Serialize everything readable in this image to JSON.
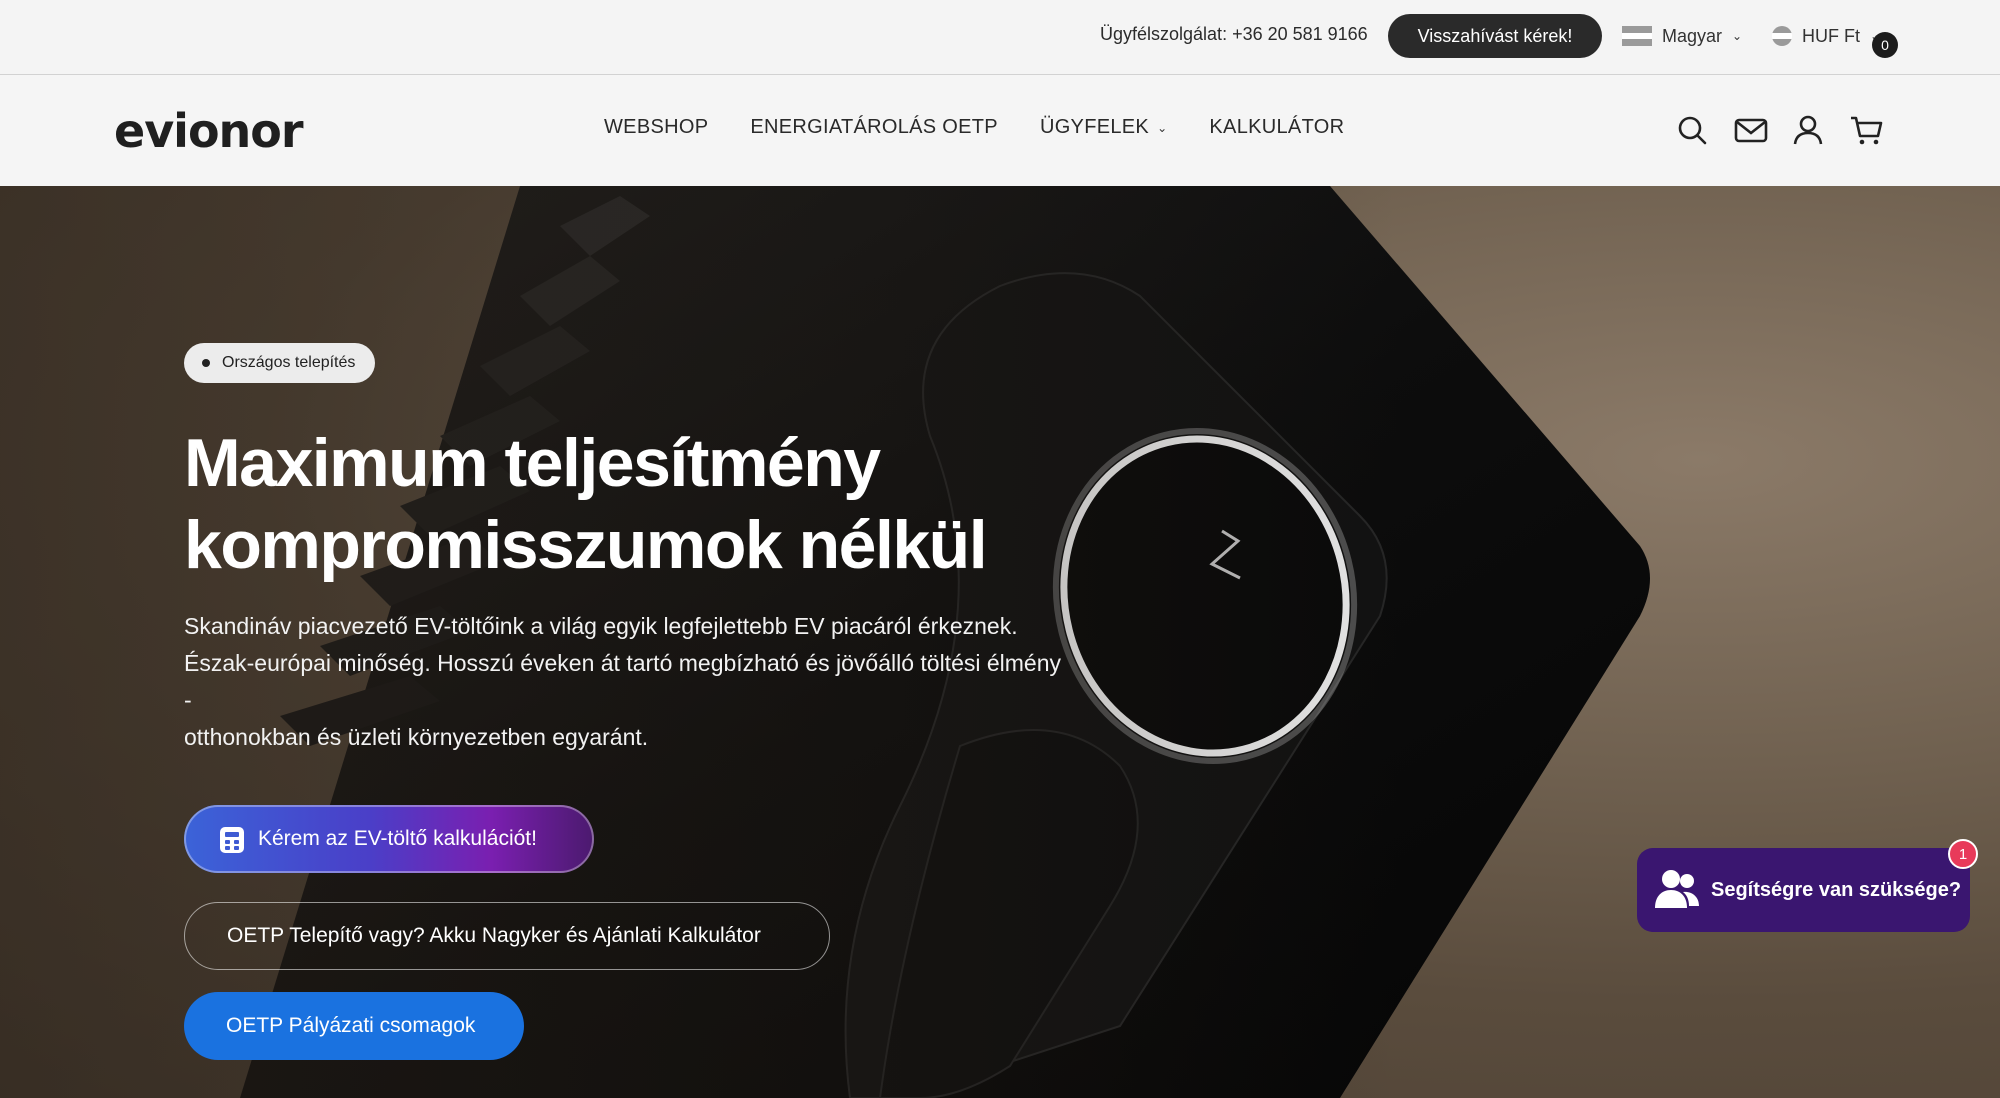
{
  "topbar": {
    "support": "Ügyfélszolgálat: +36 20 581 9166",
    "callback_label": "Visszahívást kérek!",
    "language": "Magyar",
    "currency": "HUF Ft",
    "colors": {
      "bar": "#f4f4f4",
      "callback_bg": "#2a2a2a"
    }
  },
  "header": {
    "logo": "evionor",
    "nav": [
      {
        "label": "WEBSHOP"
      },
      {
        "label": "ENERGIATÁROLÁS OETP"
      },
      {
        "label": "ÜGYFELEK",
        "has_dropdown": true
      },
      {
        "label": "KALKULÁTOR"
      }
    ],
    "icons": [
      "search-icon",
      "mail-icon",
      "account-icon",
      "cart-icon"
    ],
    "cart_count": "0"
  },
  "hero": {
    "badge": "Országos telepítés",
    "title_line1": "Maximum teljesítmény",
    "title_line2": "kompromisszumok nélkül",
    "lead_line1": "Skandináv piacvezető EV-töltőink a világ egyik legfejlettebb EV piacáról érkeznek.",
    "lead_line2": "Észak-európai minőség. Hosszú éveken át tartó megbízható és jövőálló töltési élmény",
    "lead_line3": "-",
    "lead_line4": "otthonokban és üzleti környezetben egyaránt.",
    "cta_calc": "Kérem az EV-töltő kalkulációt!",
    "cta_oetp": "OETP Telepítő vagy? Akku Nagyker és Ajánlati Kalkulátor",
    "cta_packages": "OETP Pályázati csomagok",
    "colors": {
      "cta_packages": "#1a72e0",
      "calc_gradient_start": "#3b63d8",
      "calc_gradient_end": "#4b1a6e"
    }
  },
  "chat": {
    "label": "Segítségre van szüksége?",
    "badge": "1",
    "colors": {
      "bg": "#3a1670",
      "badge": "#e83a5a"
    }
  }
}
